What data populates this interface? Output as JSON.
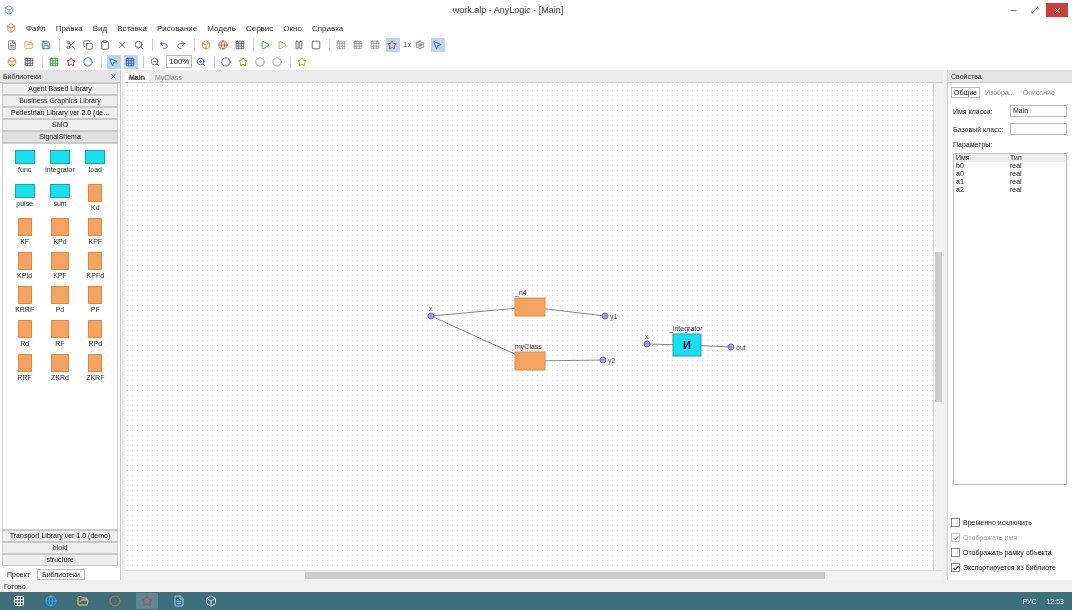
{
  "window": {
    "title": "work.alp - AnyLogic - [Main]"
  },
  "menu": [
    "Файл",
    "Правка",
    "Вид",
    "Вставка",
    "Рисование",
    "Модель",
    "Сервис",
    "Окно",
    "Справка"
  ],
  "toolbar": {
    "speed": "1x",
    "zoom": "100%"
  },
  "library_panel": {
    "title": "Библиотеки",
    "sections_top": [
      {
        "label": "Agent Based Library",
        "selected": false
      },
      {
        "label": "Business Graphics Library",
        "selected": false
      },
      {
        "label": "Pedestrian Library ver 2.0 (de...",
        "selected": false
      },
      {
        "label": "SMO",
        "selected": false
      },
      {
        "label": "SignalShema",
        "selected": true
      }
    ],
    "items": [
      {
        "label": "func",
        "kind": "signal"
      },
      {
        "label": "integrator",
        "kind": "signal"
      },
      {
        "label": "load",
        "kind": "signal"
      },
      {
        "label": "pulse",
        "kind": "signal"
      },
      {
        "label": "sum",
        "kind": "signal"
      },
      {
        "label": "Kd",
        "kind": "block"
      },
      {
        "label": "KF",
        "kind": "block"
      },
      {
        "label": "KPd",
        "kind": "block"
      },
      {
        "label": "KPF",
        "kind": "block"
      },
      {
        "label": "KPId",
        "kind": "block"
      },
      {
        "label": "KPF",
        "kind": "block"
      },
      {
        "label": "KPFd",
        "kind": "block"
      },
      {
        "label": "KRRF",
        "kind": "block"
      },
      {
        "label": "Pd",
        "kind": "block"
      },
      {
        "label": "PF",
        "kind": "block"
      },
      {
        "label": "Rd",
        "kind": "block"
      },
      {
        "label": "RF",
        "kind": "block"
      },
      {
        "label": "RPd",
        "kind": "block"
      },
      {
        "label": "RRF",
        "kind": "block"
      },
      {
        "label": "ZKRd",
        "kind": "block"
      },
      {
        "label": "ZKRF",
        "kind": "block"
      }
    ],
    "sections_bottom": [
      {
        "label": "Transport Library ver 1.0 (demo)",
        "selected": false
      },
      {
        "label": "bloki",
        "selected": false
      },
      {
        "label": "structure",
        "selected": false
      }
    ],
    "tabs": [
      {
        "label": "Проект",
        "selected": false
      },
      {
        "label": "Библиотеки",
        "selected": true
      }
    ]
  },
  "editor": {
    "tabs": [
      {
        "label": "Main",
        "selected": true
      },
      {
        "label": "MyClass",
        "selected": false
      }
    ],
    "nodes": [
      {
        "kind": "port",
        "label": "x"
      },
      {
        "kind": "block",
        "label": "_n4"
      },
      {
        "kind": "port",
        "label": "y1"
      },
      {
        "kind": "block",
        "label": "myClass"
      },
      {
        "kind": "port",
        "label": "y2"
      },
      {
        "kind": "port",
        "label": "x"
      },
      {
        "kind": "integrator",
        "label": "_integrator",
        "symbol": "И"
      },
      {
        "kind": "port",
        "label": "out"
      }
    ]
  },
  "properties": {
    "title": "Свойства",
    "tabs": [
      {
        "label": "Общие",
        "selected": true
      },
      {
        "label": "Изобра...",
        "selected": false
      },
      {
        "label": "Описание",
        "selected": false
      }
    ],
    "class_name_label": "Имя класса:",
    "class_name": "Main",
    "base_class_label": "Базовый класс:",
    "params_label": "Параметры:",
    "columns": [
      "Имя",
      "Тип"
    ],
    "rows": [
      {
        "name": "b0",
        "type": "real"
      },
      {
        "name": "a0",
        "type": "real"
      },
      {
        "name": "a1",
        "type": "real"
      },
      {
        "name": "a2",
        "type": "real"
      }
    ],
    "options": [
      {
        "label": "Временно исключить",
        "checked": false,
        "disabled": false
      },
      {
        "label": "Отображать имя",
        "checked": true,
        "disabled": true
      },
      {
        "label": "Отображать рамку объекта",
        "checked": false,
        "disabled": false
      },
      {
        "label": "Экспортируется из библиоте",
        "checked": true,
        "disabled": false
      }
    ]
  },
  "status_bar": "Готово",
  "taskbar": {
    "language": "РУС",
    "time": "12:53"
  }
}
